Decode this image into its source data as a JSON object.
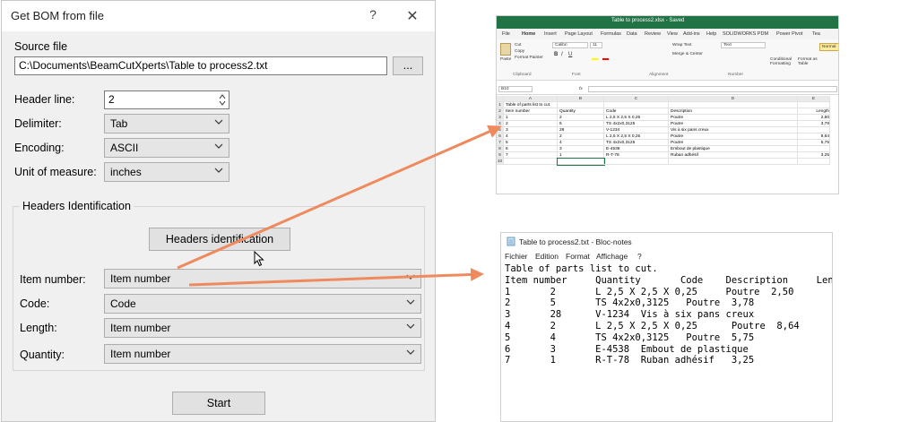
{
  "dialog": {
    "title": "Get BOM from file",
    "help_glyph": "?",
    "close_glyph": "✕",
    "source_file_label": "Source file",
    "source_file_value": "C:\\Documents\\BeamCutXperts\\Table to process2.txt",
    "browse_label": "...",
    "header_line_label": "Header line:",
    "header_line_value": "2",
    "delimiter_label": "Delimiter:",
    "delimiter_value": "Tab",
    "encoding_label": "Encoding:",
    "encoding_value": "ASCII",
    "unit_label": "Unit of measure:",
    "unit_value": "inches",
    "group_label": "Headers Identification",
    "headers_button": "Headers identification",
    "item_number_label": "Item number:",
    "item_number_value": "Item number",
    "code_label": "Code:",
    "code_value": "Code",
    "length_label": "Length:",
    "length_value": "Item number",
    "quantity_label": "Quantity:",
    "quantity_value": "Item number",
    "start_button": "Start"
  },
  "excel": {
    "title": "Table to process2.xlsx - Saved",
    "tabs": [
      "File",
      "Home",
      "Insert",
      "Page Layout",
      "Formulas",
      "Data",
      "Review",
      "View",
      "Add-ins",
      "Help",
      "SOLIDWORKS PDM",
      "Power Pivot",
      "Tea"
    ],
    "ribbon": {
      "paste": "Paste",
      "cut": "Cut",
      "copy": "Copy",
      "format_painter": "Format Painter",
      "clipboard": "Clipboard",
      "font_name": "Calibri",
      "font_size": "11",
      "font_group": "Font",
      "wrap_text": "Wrap Text",
      "merge": "Merge & Center",
      "alignment": "Alignment",
      "number_format": "Text",
      "number": "Number",
      "conditional": "Conditional Formatting",
      "format_as_table": "Format as Table",
      "style_normal": "Normal"
    },
    "name_box": "B10",
    "fx": "fx",
    "columns": [
      "A",
      "B",
      "C",
      "D",
      "E"
    ],
    "rows": [
      [
        "1",
        "Table of parts list to cut.",
        "",
        "",
        "",
        ""
      ],
      [
        "2",
        "Item number",
        "Quantity",
        "Code",
        "Description",
        "Length"
      ],
      [
        "3",
        "1",
        "2",
        "L 2,5 X 2,5 X 0,25",
        "Poutre",
        "2,50"
      ],
      [
        "4",
        "2",
        "5",
        "TS 4x2x0,3125",
        "Poutre",
        "3,78"
      ],
      [
        "5",
        "3",
        "28",
        "V-1234",
        "Vis à six pans creux",
        ""
      ],
      [
        "6",
        "4",
        "2",
        "L 2,5 X 2,5 X 0,25",
        "Poutre",
        "8,64"
      ],
      [
        "7",
        "5",
        "4",
        "TS 4x2x0,3125",
        "Poutre",
        "5,75"
      ],
      [
        "8",
        "6",
        "3",
        "E-4538",
        "Embout de plastique",
        ""
      ],
      [
        "9",
        "7",
        "1",
        "R-T-78",
        "Ruban adhésif",
        "3,25"
      ],
      [
        "10",
        "",
        "",
        "",
        "",
        ""
      ]
    ]
  },
  "notepad": {
    "title": "Table to process2.txt - Bloc-notes",
    "menu": [
      "Fichier",
      "Edition",
      "Format",
      "Affichage",
      "?"
    ],
    "lines": [
      "Table of parts list to cut.",
      "Item number     Quantity       Code    Description     Length",
      "1       2       L 2,5 X 2,5 X 0,25     Poutre  2,50",
      "2       5       TS 4x2x0,3125   Poutre  3,78",
      "3       28      V-1234  Vis à six pans creux",
      "4       2       L 2,5 X 2,5 X 0,25      Poutre  8,64",
      "5       4       TS 4x2x0,3125   Poutre  5,75",
      "6       3       E-4538  Embout de plastique",
      "7       1       R-T-78  Ruban adhésif   3,25"
    ]
  },
  "colors": {
    "arrow": "#ef8a5f",
    "excel_green": "#217346",
    "dialog_bg": "#f0f0f0"
  }
}
